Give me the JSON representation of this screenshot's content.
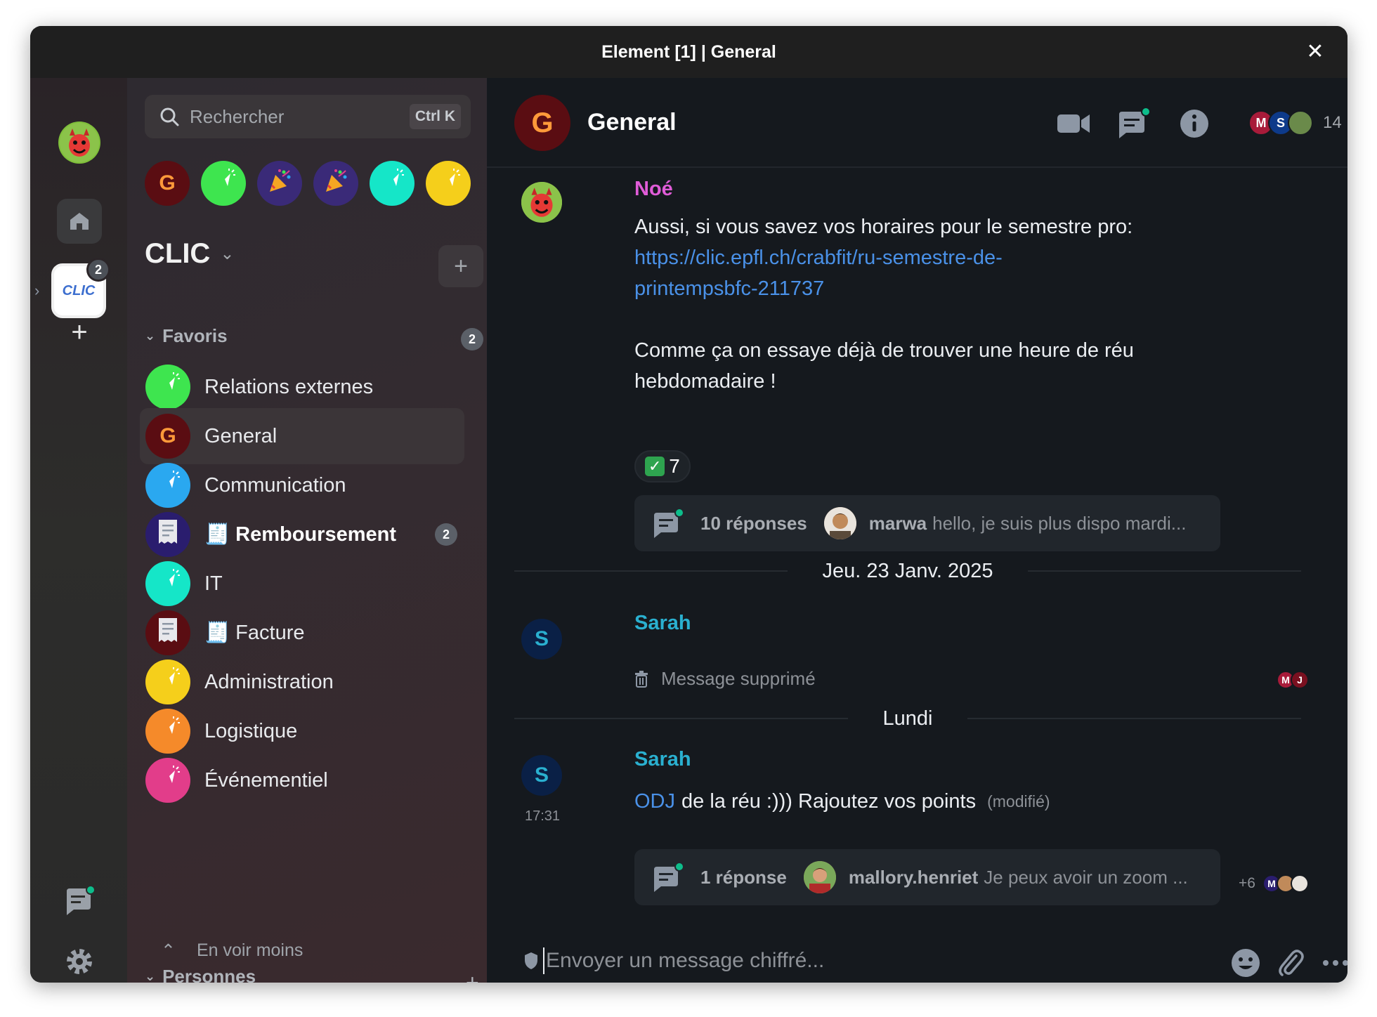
{
  "window": {
    "title": "Element [1] | General",
    "close_glyph": "✕"
  },
  "spacebar": {
    "user_avatar_icon": "devil-avatar-icon",
    "home_icon": "home-icon",
    "space": {
      "label": "CLIC",
      "badge": "2"
    },
    "add_glyph": "+",
    "threads_icon": "threads-icon",
    "settings_icon": "gear-icon"
  },
  "roomlist": {
    "search": {
      "placeholder": "Rechercher",
      "shortcut": "Ctrl K"
    },
    "breadcrumbs": [
      {
        "letter": "G",
        "color": "#5a0d12",
        "text_color": "#ff9a3a"
      },
      {
        "letter": "",
        "color": "#3ee54f",
        "icon": "cursor-icon"
      },
      {
        "letter": "",
        "color": "#3a2a78",
        "icon": "party-icon"
      },
      {
        "letter": "",
        "color": "#3a2a78",
        "icon": "party-icon"
      },
      {
        "letter": "",
        "color": "#15e6c8",
        "icon": "cursor-icon"
      },
      {
        "letter": "",
        "color": "#f5cf1b",
        "icon": "cursor-icon"
      }
    ],
    "space_name": "CLIC",
    "space_add": "+",
    "favorites_label": "Favoris",
    "favorites_badge": "2",
    "rooms": [
      {
        "name": "Relations externes",
        "color": "#3ee54f",
        "icon": "cursor-icon"
      },
      {
        "name": "General",
        "color": "#5a0d12",
        "letter": "G",
        "active": true
      },
      {
        "name": "Communication",
        "color": "#2aa8f0",
        "icon": "cursor-icon"
      },
      {
        "name": "🧾 Remboursement",
        "color": "#2a1d6e",
        "icon": "receipt-icon",
        "bold": true,
        "badge": "2"
      },
      {
        "name": "IT",
        "color": "#15e6c8",
        "icon": "cursor-icon"
      },
      {
        "name": "🧾 Facture",
        "color": "#5a0d12",
        "icon": "receipt-icon"
      },
      {
        "name": "Administration",
        "color": "#f5cf1b",
        "icon": "cursor-icon"
      },
      {
        "name": "Logistique",
        "color": "#f58a2a",
        "icon": "cursor-icon"
      },
      {
        "name": "Événementiel",
        "color": "#e23d8a",
        "icon": "cursor-icon"
      }
    ],
    "see_less": "En voir moins",
    "people_label": "Personnes",
    "people_add": "+"
  },
  "room_header": {
    "avatar_letter": "G",
    "title": "General",
    "member_count": "14",
    "members": [
      {
        "letter": "M",
        "color": "#a81b3a"
      },
      {
        "letter": "S",
        "color": "#0d3a8a"
      },
      {
        "letter": "",
        "color": "#6a8a4a"
      }
    ]
  },
  "messages": [
    {
      "sender": "Noé",
      "sender_color": "#e05cd8",
      "line1": "Aussi, si vous savez vos horaires pour le semestre pro:",
      "link1": "https://clic.epfl.ch/crabfit/ru-semestre-de-",
      "link2": "printempsbfc-211737",
      "line2": "Comme ça on essaye déjà de trouver une heure de réu",
      "line3": "hebdomadaire !",
      "reaction_count": "7",
      "thread": {
        "count": "10 réponses",
        "user": "marwa",
        "preview": "hello, je suis plus dispo mardi..."
      }
    },
    {
      "date": "Jeu. 23 Janv. 2025",
      "sender": "Sarah",
      "avatar_letter": "S",
      "sender_color": "#2ab0d0",
      "deleted_text": "Message supprimé",
      "receipts": [
        "M",
        "J"
      ]
    },
    {
      "date": "Lundi",
      "sender": "Sarah",
      "avatar_letter": "S",
      "sender_color": "#2ab0d0",
      "time": "17:31",
      "link_word": "ODJ",
      "text": "de la réu :))) Rajoutez vos points",
      "edited": "(modifié)",
      "thread": {
        "count": "1 réponse",
        "user": "mallory.henriet",
        "preview": "Je peux avoir un zoom ..."
      },
      "extra_receipts": "+6",
      "receipt_letter": "M"
    }
  ],
  "composer": {
    "placeholder": "Envoyer un message chiffré...",
    "emoji_icon": "emoji-icon",
    "attach_icon": "paperclip-icon",
    "more_icon": "more-horizontal-icon"
  }
}
